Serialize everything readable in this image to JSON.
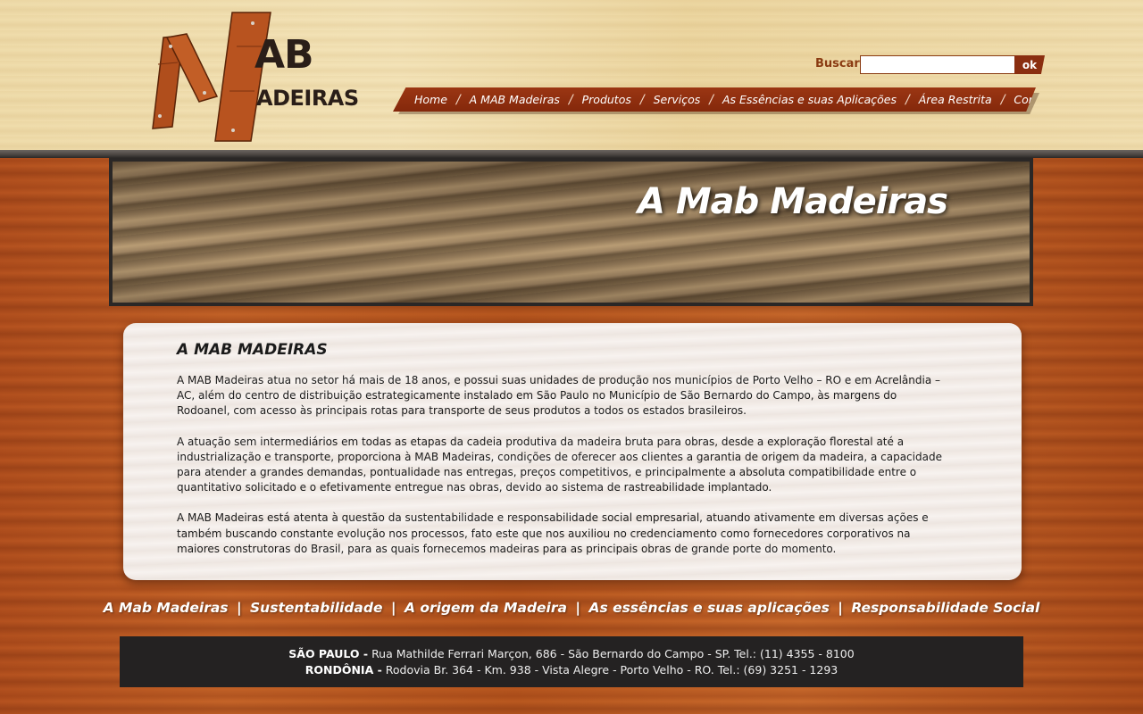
{
  "logo": {
    "line1": "AB",
    "line2": "ADEIRAS",
    "alt": "MAB Madeiras"
  },
  "search": {
    "label": "Buscar",
    "value": "",
    "placeholder": "",
    "button_label": "ok"
  },
  "nav": {
    "items": [
      {
        "label": "Home"
      },
      {
        "label": "A MAB Madeiras"
      },
      {
        "label": "Produtos"
      },
      {
        "label": "Serviços"
      },
      {
        "label": "As Essências e suas Aplicações"
      },
      {
        "label": "Área Restrita"
      },
      {
        "label": "Contato"
      }
    ],
    "separator": "/"
  },
  "banner": {
    "title": "A Mab Madeiras"
  },
  "content": {
    "title": "A MAB MADEIRAS",
    "paragraphs": [
      "A MAB Madeiras atua no setor há mais de 18 anos, e possui suas unidades de produção nos municípios de Porto Velho – RO e em Acrelândia – AC, além do centro de distribuição estrategicamente instalado em São Paulo no Município de São Bernardo do Campo, às margens do Rodoanel, com acesso às principais rotas para transporte de seus produtos a todos os estados brasileiros.",
      "A atuação sem intermediários em todas as etapas da cadeia produtiva da madeira bruta para obras, desde a exploração florestal até a industrialização e transporte, proporciona à MAB Madeiras, condições de oferecer aos clientes a garantia de origem da madeira, a capacidade para atender a grandes demandas, pontualidade nas entregas, preços competitivos, e principalmente a absoluta compatibilidade entre o quantitativo solicitado e o efetivamente entregue nas obras, devido ao sistema de rastreabilidade implantado.",
      "A MAB Madeiras está atenta à questão da sustentabilidade e responsabilidade social empresarial, atuando ativamente em diversas ações e também buscando constante evolução nos processos, fato este que nos auxiliou no credenciamento como fornecedores corporativos na maiores construtoras do Brasil, para as quais fornecemos madeiras para as principais obras de grande porte do momento."
    ]
  },
  "footer_links": {
    "items": [
      {
        "label": "A Mab Madeiras"
      },
      {
        "label": "Sustentabilidade"
      },
      {
        "label": "A origem da Madeira"
      },
      {
        "label": "As essências e suas aplicações"
      },
      {
        "label": "Responsabilidade Social"
      }
    ],
    "separator": "|"
  },
  "address": {
    "sp_label": "SÃO PAULO -",
    "sp_text": "Rua Mathilde Ferrari Marçon, 686 - São Bernardo do Campo - SP. Tel.: (11) 4355 - 8100",
    "ro_label": "RONDÔNIA -",
    "ro_text": "Rodovia Br. 364 - Km. 938 - Vista Alegre - Porto Velho - RO. Tel.: (69) 3251 - 1293"
  },
  "colors": {
    "brand_red": "#8a2e10",
    "nav_bg": "#9b3613",
    "footer_bg": "#242222",
    "logo_text": "#2a1e18"
  }
}
